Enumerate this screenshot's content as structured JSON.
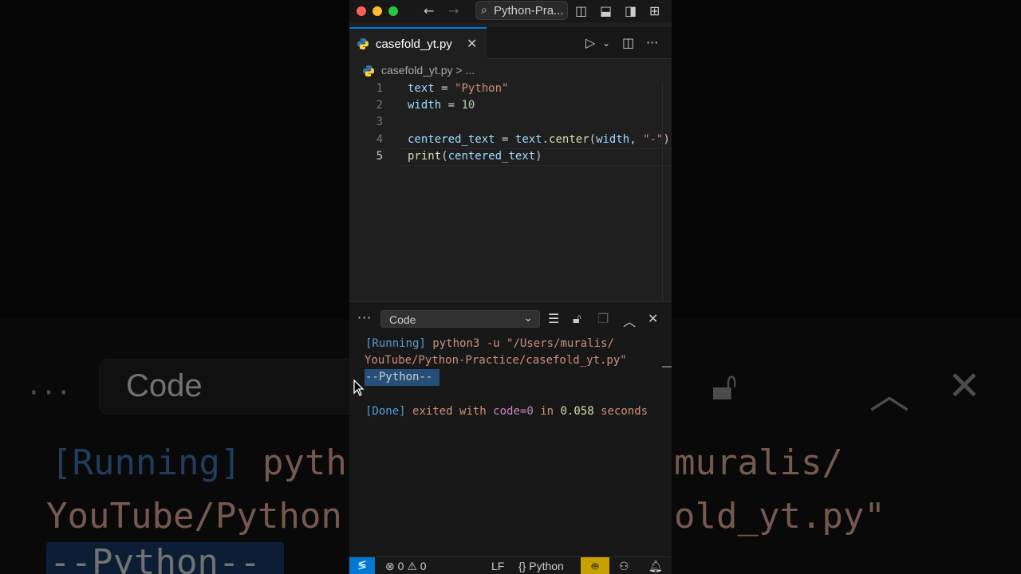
{
  "window": {
    "search_label": "Python-Pra...",
    "tab_label": "casefold_yt.py",
    "breadcrumb": "casefold_yt.py > ..."
  },
  "editor": {
    "lines": [
      {
        "num": "1",
        "text": "text = \"Python\""
      },
      {
        "num": "2",
        "text": "width = 10"
      },
      {
        "num": "3",
        "text": ""
      },
      {
        "num": "4",
        "text": "centered_text = text.center(width, \"-\")"
      },
      {
        "num": "5",
        "text": "print(centered_text)"
      }
    ],
    "active_line": "5"
  },
  "panel": {
    "selected_output": "Code",
    "running_tag": "[Running]",
    "running_cmd_1": "python3 -u \"/Users/muralis/",
    "running_cmd_2": "YouTube/Python-Practice/casefold_yt.py\"",
    "result": "--Python--",
    "done_tag": "[Done]",
    "done_text": "exited with",
    "done_code": "code=0",
    "done_in": "in",
    "done_time": "0.058",
    "done_seconds": "seconds"
  },
  "statusbar": {
    "errors": "0",
    "warnings": "0",
    "eol": "LF",
    "language": "Python"
  },
  "colors": {
    "accent": "#0078d4",
    "copilot": "#c8a100",
    "selection": "#264f78"
  },
  "background": {
    "dots": "···",
    "select": "Code",
    "running": "[Running]",
    "pyth": "pyth",
    "youtube": "YouTube/Python",
    "result": "--Python--",
    "muralis": "muralis/",
    "old_yt": "old_yt.py\""
  }
}
